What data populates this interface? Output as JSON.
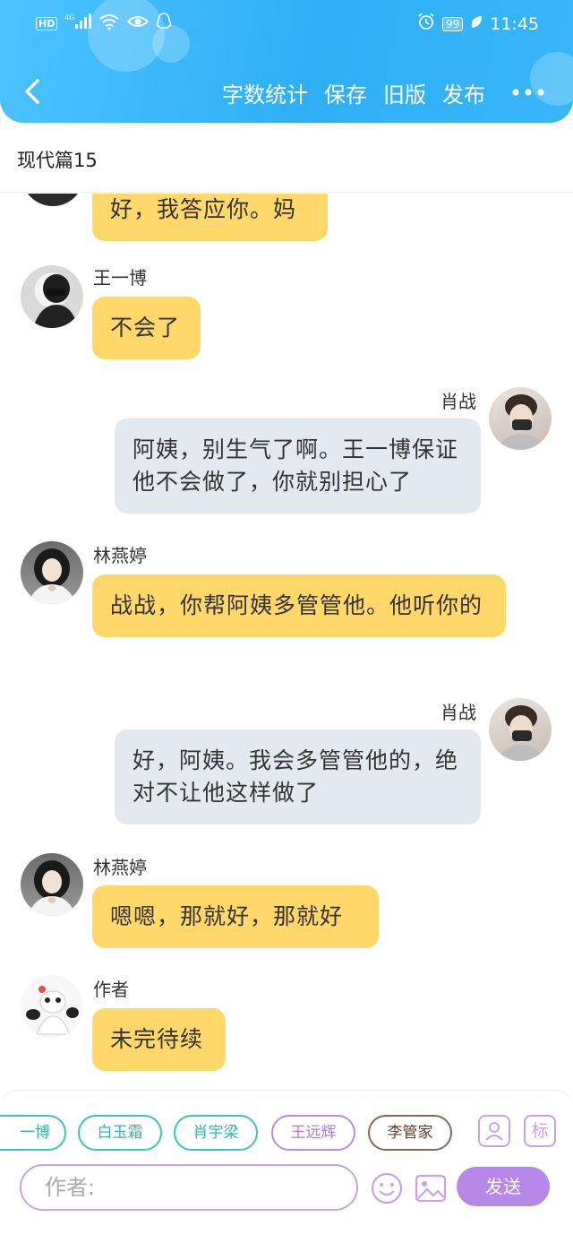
{
  "status_bar": {
    "network": "HD",
    "signal": "4G",
    "battery": "99",
    "time": "11:45"
  },
  "header": {
    "actions": [
      "字数统计",
      "保存",
      "旧版",
      "发布"
    ]
  },
  "page_title": "现代篇15",
  "messages": [
    {
      "side": "left",
      "name": "",
      "text": "好，我答应你。妈"
    },
    {
      "side": "left",
      "name": "王一博",
      "text": "不会了"
    },
    {
      "side": "right",
      "name": "肖战",
      "text": "阿姨，别生气了啊。王一博保证他不会做了，你就别担心了"
    },
    {
      "side": "left",
      "name": "林燕婷",
      "text": "战战，你帮阿姨多管管他。他听你的"
    },
    {
      "side": "right",
      "name": "肖战",
      "text": "好，阿姨。我会多管管他的，绝对不让他这样做了"
    },
    {
      "side": "left",
      "name": "林燕婷",
      "text": "嗯嗯，那就好，那就好"
    },
    {
      "side": "left",
      "name": "作者",
      "text": "未完待续"
    }
  ],
  "character_chips": [
    {
      "label": "一博",
      "color": "teal"
    },
    {
      "label": "白玉霜",
      "color": "teal"
    },
    {
      "label": "肖宇梁",
      "color": "teal"
    },
    {
      "label": "王远辉",
      "color": "purple"
    },
    {
      "label": "李管家",
      "color": "brown"
    }
  ],
  "tools": {
    "mark_label": "标"
  },
  "composer": {
    "placeholder": "作者:",
    "send_label": "发送"
  },
  "colors": {
    "header": "#2eaff5",
    "left_bubble": "#ffd86a",
    "right_bubble": "#e4e8ef",
    "accent": "#b689e8"
  }
}
